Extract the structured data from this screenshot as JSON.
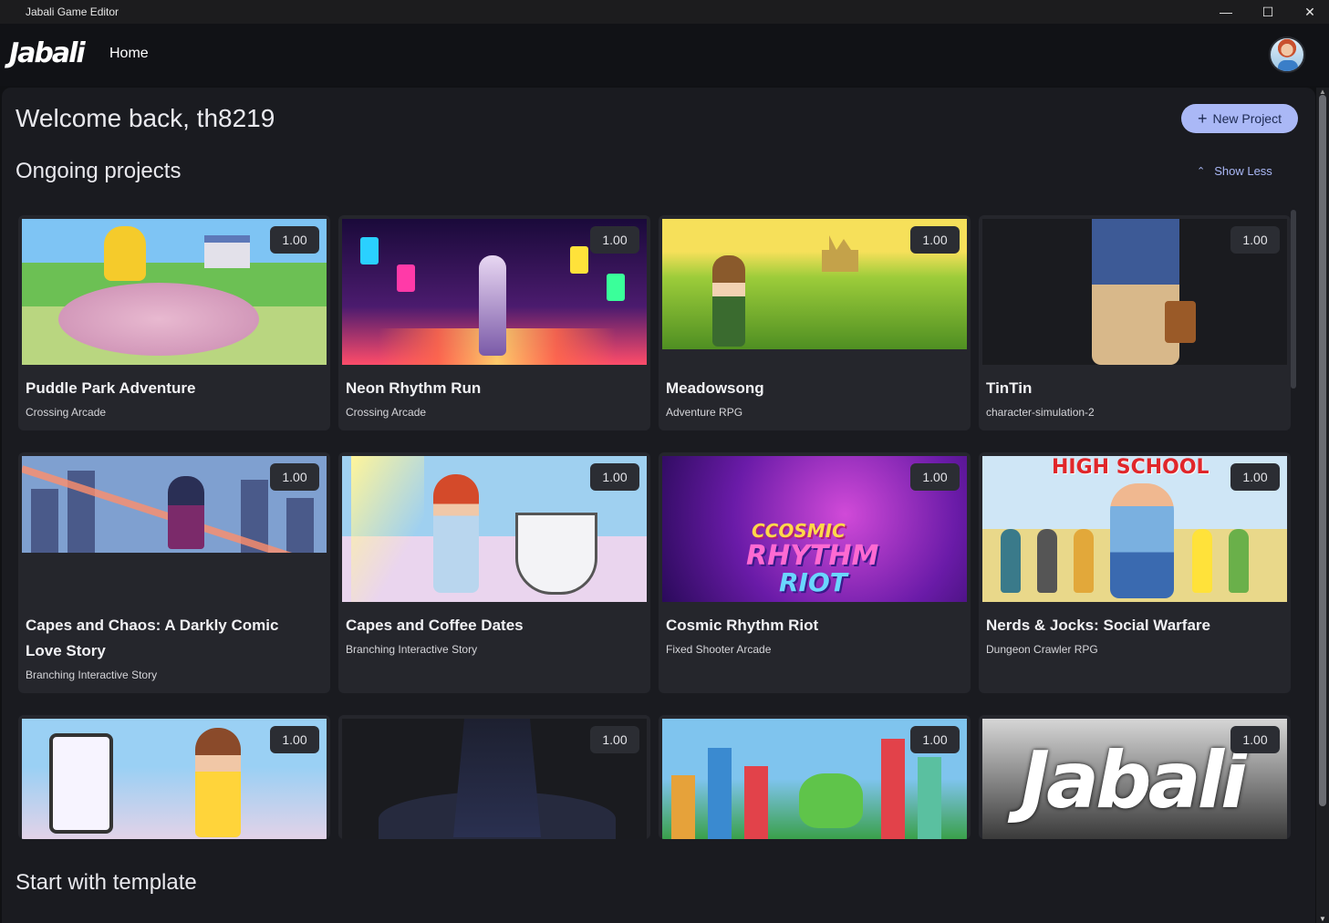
{
  "window": {
    "title": "Jabali Game Editor",
    "controls": {
      "minimize": "—",
      "maximize": "☐",
      "close": "✕"
    }
  },
  "appbar": {
    "logo": "Jabali",
    "nav": {
      "home": "Home"
    },
    "avatar_icon": "user-avatar"
  },
  "main": {
    "welcome": "Welcome back, th8219",
    "new_project": {
      "icon": "+",
      "label": "New Project"
    },
    "ongoing_title": "Ongoing projects",
    "show_less": {
      "icon": "⌃",
      "label": "Show Less"
    },
    "template_title": "Start with template"
  },
  "projects": [
    {
      "title": "Puddle Park Adventure",
      "genre": "Crossing Arcade",
      "version": "1.00"
    },
    {
      "title": "Neon Rhythm Run",
      "genre": "Crossing Arcade",
      "version": "1.00"
    },
    {
      "title": "Meadowsong",
      "genre": "Adventure RPG",
      "version": "1.00"
    },
    {
      "title": "TinTin",
      "genre": "character-simulation-2",
      "version": "1.00"
    },
    {
      "title": "Capes and Chaos: A Darkly Comic Love Story",
      "genre": "Branching Interactive Story",
      "version": "1.00"
    },
    {
      "title": "Capes and Coffee Dates",
      "genre": "Branching Interactive Story",
      "version": "1.00"
    },
    {
      "title": "Cosmic Rhythm Riot",
      "genre": "Fixed Shooter Arcade",
      "version": "1.00",
      "art_text": [
        "CCOSMIC",
        "RHYTHM",
        "RIOT"
      ]
    },
    {
      "title": "Nerds & Jocks: Social Warfare",
      "genre": "Dungeon Crawler RPG",
      "version": "1.00",
      "art_text": [
        "HIGH SCHOOL"
      ]
    },
    {
      "version": "1.00"
    },
    {
      "version": "1.00"
    },
    {
      "version": "1.00"
    },
    {
      "version": "1.00",
      "art_text": [
        "Jabali"
      ]
    }
  ]
}
